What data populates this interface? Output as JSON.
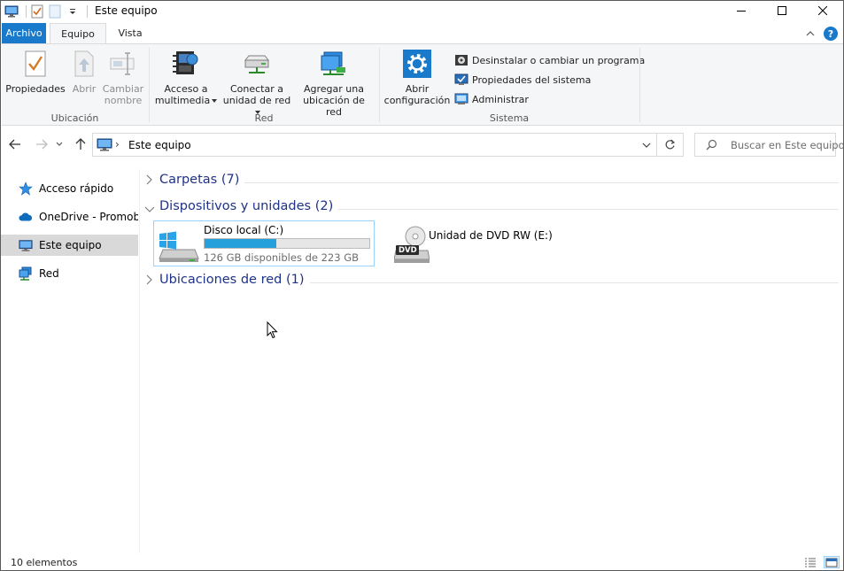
{
  "window": {
    "title": "Este equipo",
    "minimize_glyph": "—",
    "maximize_glyph": "☐",
    "close_glyph": "✕"
  },
  "ribbon_tabs": {
    "file": "Archivo",
    "home": "Equipo",
    "view": "Vista",
    "help_glyph": "?"
  },
  "ribbon": {
    "location": {
      "label": "Ubicación",
      "properties": "Propiedades",
      "open": "Abrir",
      "rename_line1": "Cambiar",
      "rename_line2": "nombre"
    },
    "network": {
      "label": "Red",
      "media_line1": "Acceso a",
      "media_line2": "multimedia",
      "map_line1": "Conectar a",
      "map_line2": "unidad de red",
      "add_line1": "Agregar una",
      "add_line2": "ubicación de red"
    },
    "system": {
      "label": "Sistema",
      "settings_line1": "Abrir",
      "settings_line2": "configuración",
      "uninstall": "Desinstalar o cambiar un programa",
      "sys_props": "Propiedades del sistema",
      "manage": "Administrar"
    }
  },
  "address": {
    "path": "Este equipo",
    "search_placeholder": "Buscar en Este equipo"
  },
  "nav_pane": {
    "items": [
      {
        "label": "Acceso rápido",
        "icon": "star-icon"
      },
      {
        "label": "OneDrive - Promob S",
        "icon": "cloud-icon"
      },
      {
        "label": "Este equipo",
        "icon": "computer-icon"
      },
      {
        "label": "Red",
        "icon": "network-icon"
      }
    ]
  },
  "content": {
    "folders_header": "Carpetas (7)",
    "devices_header": "Dispositivos y unidades (2)",
    "network_header": "Ubicaciones de red (1)",
    "drives": [
      {
        "name": "Disco local (C:)",
        "free": "126 GB disponibles de 223 GB",
        "used_fraction": 0.435
      },
      {
        "name": "Unidad de DVD RW (E:)",
        "badge": "DVD"
      }
    ]
  },
  "status": {
    "count": "10 elementos"
  },
  "colors": {
    "accent": "#1979ca",
    "progress": "#26a0da",
    "header_text": "#1e3287"
  }
}
